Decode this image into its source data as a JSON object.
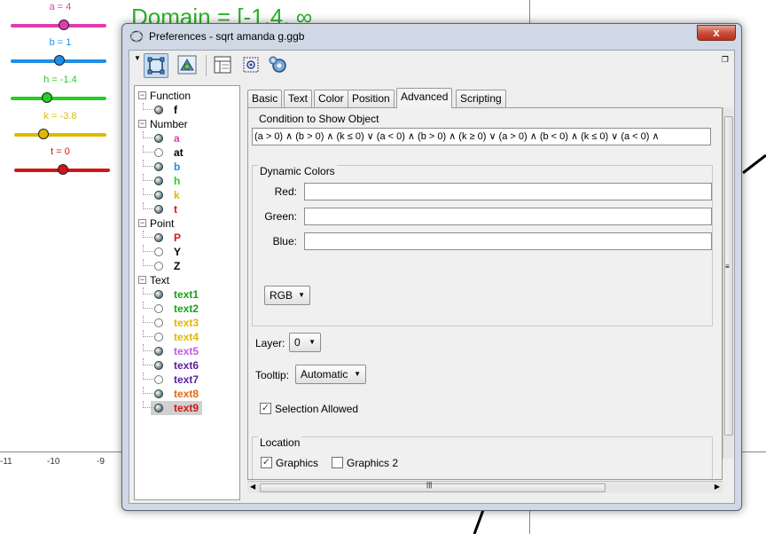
{
  "background": {
    "domain_text": "Domain = [-1.4, ∞",
    "sliders": [
      {
        "label": "a = 4",
        "color": "#e23cae",
        "value": 4
      },
      {
        "label": "b = 1",
        "color": "#1e8fe6",
        "value": 1
      },
      {
        "label": "h = -1.4",
        "color": "#22d022",
        "value": -1.4
      },
      {
        "label": "k = -3.8",
        "color": "#e0b800",
        "value": -3.8
      },
      {
        "label": "t = 0",
        "color": "#d21616",
        "value": 0
      }
    ],
    "axis_ticks": [
      "-11",
      "-10",
      "-9"
    ]
  },
  "window": {
    "title": "Preferences - sqrt amanda g.ggb",
    "close_label": "x"
  },
  "toolbar": {
    "buttons": [
      "object-properties-icon",
      "graphics-icon",
      "layout-icon",
      "advanced-settings-icon",
      "defaults-icon"
    ]
  },
  "tree": {
    "categories": [
      {
        "label": "Function",
        "items": [
          {
            "name": "f",
            "color": "#000000",
            "visible": true
          }
        ]
      },
      {
        "label": "Number",
        "items": [
          {
            "name": "a",
            "color": "#e23cae",
            "visible": true
          },
          {
            "name": "at",
            "color": "#000000",
            "visible": false
          },
          {
            "name": "b",
            "color": "#1e8fe6",
            "visible": true
          },
          {
            "name": "h",
            "color": "#22d022",
            "visible": true
          },
          {
            "name": "k",
            "color": "#e0b800",
            "visible": true
          },
          {
            "name": "t",
            "color": "#d21616",
            "visible": true
          }
        ]
      },
      {
        "label": "Point",
        "items": [
          {
            "name": "P",
            "color": "#d21616",
            "visible": true
          },
          {
            "name": "Y",
            "color": "#000000",
            "visible": false
          },
          {
            "name": "Z",
            "color": "#000000",
            "visible": false
          }
        ]
      },
      {
        "label": "Text",
        "items": [
          {
            "name": "text1",
            "color": "#16a416",
            "visible": true
          },
          {
            "name": "text2",
            "color": "#16a416",
            "visible": false
          },
          {
            "name": "text3",
            "color": "#e0b800",
            "visible": false
          },
          {
            "name": "text4",
            "color": "#e0b800",
            "visible": false
          },
          {
            "name": "text5",
            "color": "#c25ce0",
            "visible": true
          },
          {
            "name": "text6",
            "color": "#5a1e9e",
            "visible": true
          },
          {
            "name": "text7",
            "color": "#5a1e9e",
            "visible": false
          },
          {
            "name": "text8",
            "color": "#e06a16",
            "visible": true
          },
          {
            "name": "text9",
            "color": "#d21616",
            "visible": true,
            "selected": true
          }
        ]
      }
    ]
  },
  "tabs": [
    "Basic",
    "Text",
    "Color",
    "Position",
    "Advanced",
    "Scripting"
  ],
  "active_tab": "Advanced",
  "advanced": {
    "condition_title": "Condition to Show Object",
    "condition_value": "(a > 0) ∧ (b > 0) ∧ (k ≤ 0) ∨ (a < 0) ∧ (b > 0) ∧ (k ≥ 0) ∨ (a > 0) ∧ (b < 0) ∧ (k ≤ 0) ∨ (a < 0) ∧",
    "dynamic_colors_title": "Dynamic Colors",
    "red_label": "Red:",
    "green_label": "Green:",
    "blue_label": "Blue:",
    "red_value": "",
    "green_value": "",
    "blue_value": "",
    "color_space": "RGB",
    "layer_label": "Layer:",
    "layer_value": "0",
    "tooltip_label": "Tooltip:",
    "tooltip_value": "Automatic",
    "selection_allowed_label": "Selection Allowed",
    "selection_allowed": true,
    "location_title": "Location",
    "graphics_label": "Graphics",
    "graphics_checked": true,
    "graphics2_label": "Graphics 2",
    "graphics2_checked": false
  }
}
